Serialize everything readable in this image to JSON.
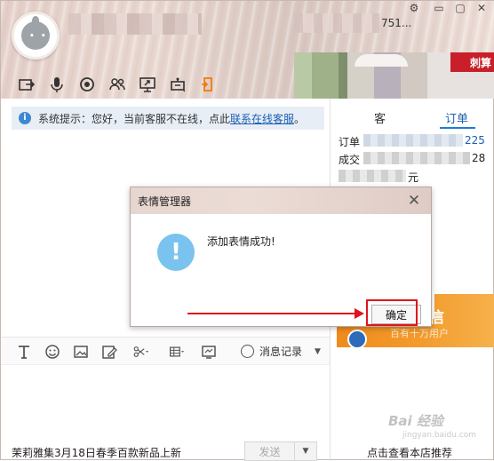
{
  "header": {
    "visible_id_fragment": "751...",
    "controls": {
      "settings": "⚙",
      "minimize": "▭",
      "maximize": "▢",
      "close": "✕"
    },
    "toolbar_icons": [
      "folder-send-icon",
      "microphone-icon",
      "camera-icon",
      "contacts-icon",
      "screen-share-icon",
      "remote-assist-icon",
      "orange-tag-icon"
    ],
    "ad_badge": "刺算"
  },
  "chat": {
    "notice_prefix": "系统提示：您好，当前客服不在线，点此",
    "notice_link": "联系在线客服",
    "notice_suffix": "。",
    "composer_icons": [
      "font-icon",
      "emoji-icon",
      "image-icon",
      "edit-icon",
      "scissors-icon",
      "table-icon",
      "screenshot-icon"
    ],
    "message_record": "消息记录",
    "status_text": "茉莉雅集3月18日春季百款新品上新",
    "send_label": "发送"
  },
  "side": {
    "tab_left_fragment": "客",
    "tab_order": "订单",
    "order_label_fragment": "订单",
    "order_number_fragment": "225",
    "deal_label_fragment": "成交",
    "deal_number_fragment": "28",
    "price_suffix": "元",
    "banner_text": "信",
    "banner_sub": "百有十万用户",
    "store_link": "点击查看本店推荐"
  },
  "dialog": {
    "title": "表情管理器",
    "message": "添加表情成功!",
    "ok_label": "确定",
    "close_symbol": "✕",
    "icon_symbol": "!"
  },
  "watermark": {
    "text": "Bai 经验",
    "sub": "jingyan.baidu.com"
  },
  "colors": {
    "accent_blue": "#1a5fb4",
    "annotation_red": "#e0141c",
    "banner_orange": "#f39a2a"
  }
}
